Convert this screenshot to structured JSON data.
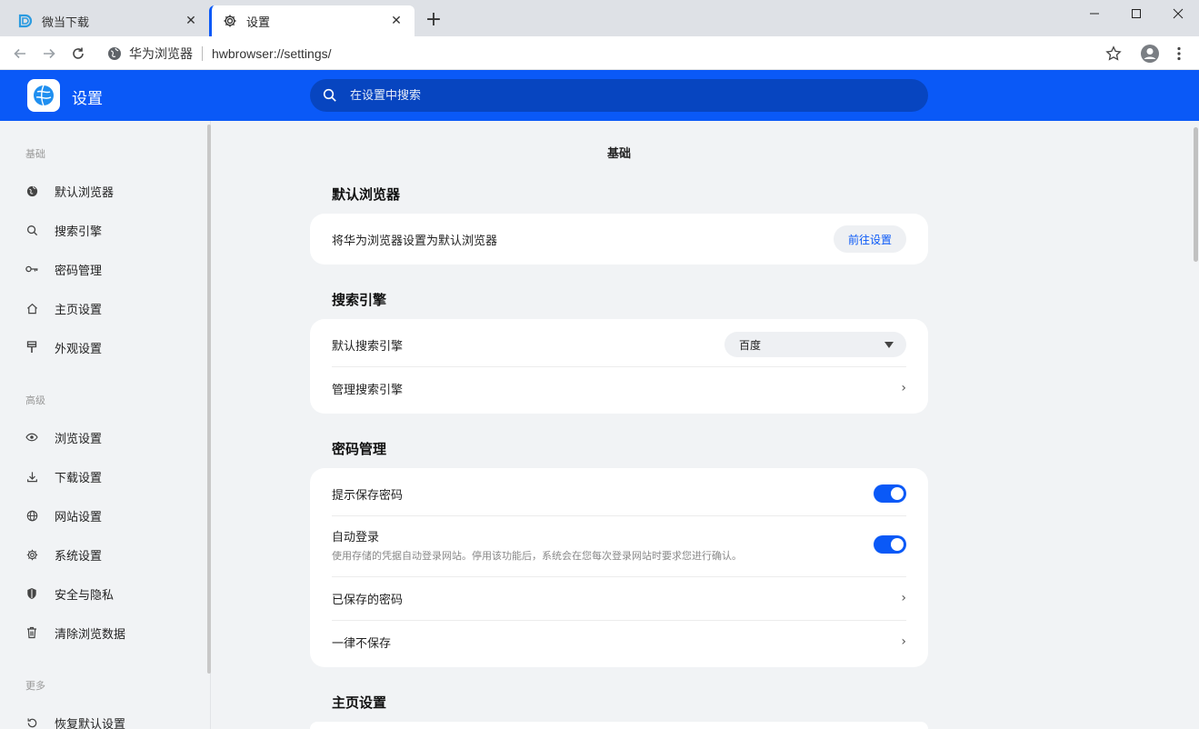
{
  "tabs": [
    {
      "title": "微当下载",
      "favicon": "weidown-logo-icon",
      "active": false
    },
    {
      "title": "设置",
      "favicon": "gear-icon",
      "active": true
    }
  ],
  "address": {
    "site_name": "华为浏览器",
    "url": "hwbrowser://settings/"
  },
  "header": {
    "title": "设置",
    "search_placeholder": "在设置中搜索",
    "accent": "#0a59f7"
  },
  "sidebar": {
    "groups": [
      {
        "label": "基础",
        "items": [
          {
            "label": "默认浏览器",
            "icon": "globe-icon"
          },
          {
            "label": "搜索引擎",
            "icon": "search-icon"
          },
          {
            "label": "密码管理",
            "icon": "key-icon"
          },
          {
            "label": "主页设置",
            "icon": "home-icon"
          },
          {
            "label": "外观设置",
            "icon": "brush-icon"
          }
        ]
      },
      {
        "label": "高级",
        "items": [
          {
            "label": "浏览设置",
            "icon": "eye-icon"
          },
          {
            "label": "下载设置",
            "icon": "download-icon"
          },
          {
            "label": "网站设置",
            "icon": "globe-grid-icon"
          },
          {
            "label": "系统设置",
            "icon": "gear-icon"
          },
          {
            "label": "安全与隐私",
            "icon": "shield-icon"
          },
          {
            "label": "清除浏览数据",
            "icon": "trash-icon"
          }
        ]
      },
      {
        "label": "更多",
        "items": [
          {
            "label": "恢复默认设置",
            "icon": "restore-icon"
          }
        ]
      }
    ]
  },
  "main": {
    "page_title": "基础",
    "default_browser": {
      "title": "默认浏览器",
      "row_label": "将华为浏览器设置为默认浏览器",
      "button": "前往设置"
    },
    "search_engine": {
      "title": "搜索引擎",
      "default_label": "默认搜索引擎",
      "default_value": "百度",
      "manage_label": "管理搜索引擎"
    },
    "password": {
      "title": "密码管理",
      "prompt_save_label": "提示保存密码",
      "prompt_save_on": true,
      "auto_login_label": "自动登录",
      "auto_login_desc": "使用存储的凭据自动登录网站。停用该功能后，系统会在您每次登录网站时要求您进行确认。",
      "auto_login_on": true,
      "saved_label": "已保存的密码",
      "never_label": "一律不保存"
    },
    "homepage": {
      "title": "主页设置"
    }
  }
}
